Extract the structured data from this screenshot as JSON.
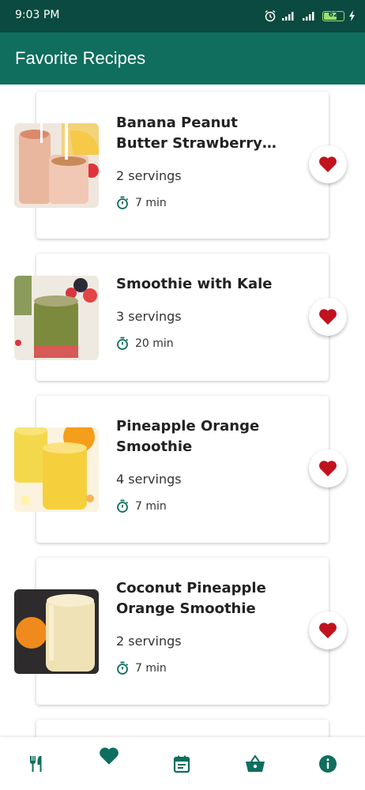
{
  "status_bar": {
    "time": "9:03 PM",
    "battery": "62"
  },
  "app_bar": {
    "title": "Favorite Recipes"
  },
  "recipes": [
    {
      "title": "Banana Peanut Butter Strawberry S...",
      "servings": "2 servings",
      "time": "7 min",
      "favorite": true
    },
    {
      "title": "Smoothie with Kale",
      "servings": "3 servings",
      "time": "20 min",
      "favorite": true
    },
    {
      "title": "Pineapple Orange Smoothie",
      "servings": "4 servings",
      "time": "7 min",
      "favorite": true
    },
    {
      "title": "Coconut Pineapple Orange Smoothie",
      "servings": "2 servings",
      "time": "7 min",
      "favorite": true
    }
  ],
  "bottom_nav": {
    "items": [
      "fork-knife-icon",
      "heart-icon",
      "calendar-note-icon",
      "basket-icon",
      "info-icon"
    ],
    "active": "heart-icon"
  },
  "colors": {
    "primary": "#0f6e5e",
    "status_bar": "#0b4a40",
    "heart": "#c1121f",
    "accent": "#0f6e5e"
  }
}
